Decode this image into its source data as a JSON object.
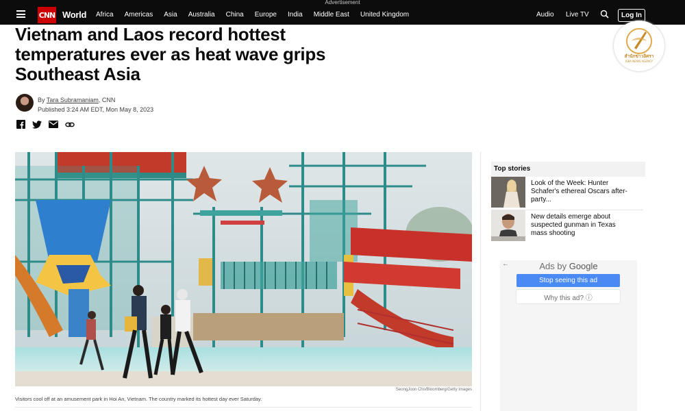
{
  "advertisement_label": "Advertisement",
  "header": {
    "logo": "CNN",
    "section": "World",
    "nav_items": [
      "Africa",
      "Americas",
      "Asia",
      "Australia",
      "China",
      "Europe",
      "India",
      "Middle East",
      "United Kingdom"
    ],
    "audio": "Audio",
    "live_tv": "Live TV",
    "login": "Log In"
  },
  "article": {
    "headline": "Vietnam and Laos record hottest temperatures ever as heat wave grips Southeast Asia",
    "byline_prefix": "By ",
    "author": "Tara Subramaniam",
    "outlet": ", CNN",
    "published": "Published 3:24 AM EDT, Mon May 8, 2023",
    "image_credit": "SeongJoon Cho/Bloomberg/Getty Images",
    "caption": "Visitors cool off at an amusement park in Hoi An, Vietnam. The country marked its hottest day ever Saturday."
  },
  "rail": {
    "top_stories_title": "Top stories",
    "stories": [
      {
        "headline": "Look of the Week: Hunter Schafer's ethereal Oscars after-party..."
      },
      {
        "headline": "New details emerge about suspected gunman in Texas mass shooting"
      }
    ]
  },
  "ad": {
    "ads_by": "Ads by ",
    "google": "Google",
    "stop_button": "Stop seeing this ad",
    "why_button": "Why this ad? ⓘ"
  },
  "watermark": {
    "text_th": "สำนักข่าวอิศรา",
    "text_en": "ISRA NEWS AGENCY"
  },
  "colors": {
    "topbar": "#0c0c0c",
    "brand_red": "#cc0000",
    "ad_blue": "#4a8af4"
  }
}
